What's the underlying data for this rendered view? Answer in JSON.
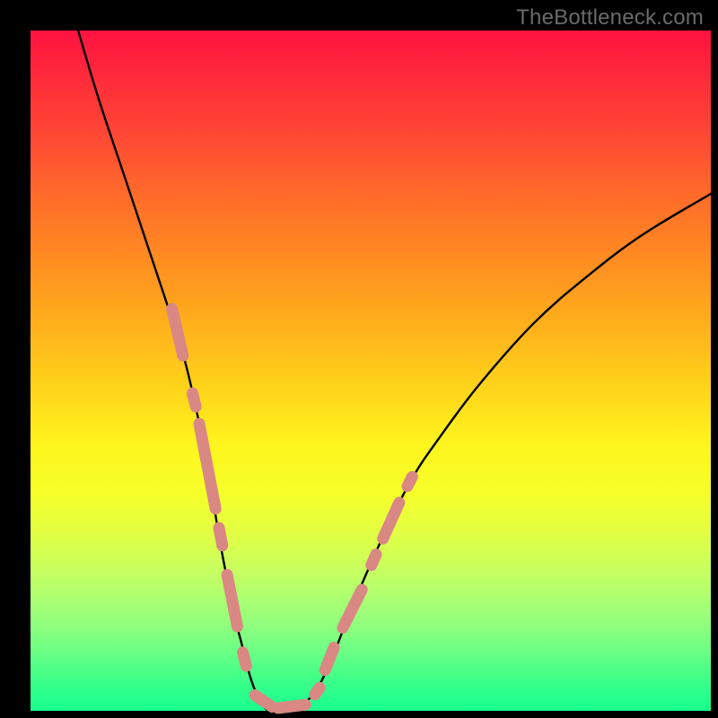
{
  "watermark": "TheBottleneck.com",
  "chart_data": {
    "type": "line",
    "title": "",
    "xlabel": "",
    "ylabel": "",
    "xlim": [
      0,
      100
    ],
    "ylim": [
      0,
      100
    ],
    "grid": false,
    "legend": false,
    "series": [
      {
        "name": "bottleneck-curve",
        "x": [
          7,
          10,
          14,
          18,
          20,
          22,
          24,
          26,
          27,
          28,
          30,
          31,
          32,
          33,
          34,
          35,
          36,
          38,
          40,
          42,
          44,
          46,
          48,
          52,
          56,
          60,
          66,
          74,
          82,
          90,
          100
        ],
        "y": [
          100,
          90,
          78,
          66,
          60,
          54,
          46,
          36,
          30,
          24,
          14,
          10,
          6,
          3,
          1,
          0,
          0,
          0,
          1,
          3,
          7,
          12,
          17,
          26,
          34,
          40,
          48,
          57,
          64,
          70,
          76
        ]
      }
    ],
    "markers": [
      {
        "name": "left-branch-dashes",
        "color": "#d98884",
        "segments": [
          {
            "x0": 20.8,
            "y0": 59.1,
            "x1": 22.4,
            "y1": 52.2
          },
          {
            "x0": 23.8,
            "y0": 46.7,
            "x1": 24.3,
            "y1": 44.7
          },
          {
            "x0": 24.8,
            "y0": 42.2,
            "x1": 27.2,
            "y1": 29.7
          },
          {
            "x0": 27.7,
            "y0": 26.9,
            "x1": 28.2,
            "y1": 24.3
          },
          {
            "x0": 28.9,
            "y0": 20.0,
            "x1": 30.4,
            "y1": 12.4
          },
          {
            "x0": 31.2,
            "y0": 8.6,
            "x1": 31.7,
            "y1": 6.6
          }
        ]
      },
      {
        "name": "trough-dashes",
        "color": "#d98884",
        "segments": [
          {
            "x0": 33.0,
            "y0": 2.3,
            "x1": 35.5,
            "y1": 0.6
          },
          {
            "x0": 36.4,
            "y0": 0.4,
            "x1": 40.4,
            "y1": 0.9
          },
          {
            "x0": 41.8,
            "y0": 2.4,
            "x1": 42.5,
            "y1": 3.4
          }
        ]
      },
      {
        "name": "right-branch-dashes",
        "color": "#d98884",
        "segments": [
          {
            "x0": 43.3,
            "y0": 6.0,
            "x1": 44.6,
            "y1": 9.3
          },
          {
            "x0": 45.9,
            "y0": 12.2,
            "x1": 48.7,
            "y1": 17.8
          },
          {
            "x0": 50.1,
            "y0": 21.4,
            "x1": 50.8,
            "y1": 23.0
          },
          {
            "x0": 51.8,
            "y0": 25.3,
            "x1": 54.2,
            "y1": 30.6
          },
          {
            "x0": 55.4,
            "y0": 33.0,
            "x1": 56.1,
            "y1": 34.4
          }
        ]
      }
    ]
  }
}
